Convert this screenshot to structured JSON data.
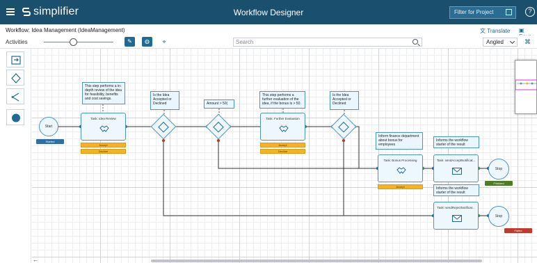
{
  "header": {
    "app_name": "simplifier",
    "title": "Workflow Designer",
    "filter_button": "Filter for Project",
    "help": "?"
  },
  "subheader": {
    "workflow_title": "Workflow: Idea Management (IdeaManagement)",
    "translate_label": "Translate",
    "save_label": "Save"
  },
  "toolbar": {
    "activities_label": "Activities",
    "search_placeholder": "Search",
    "routing_value": "Angled"
  },
  "palette": {
    "items": [
      "user-task-icon",
      "gateway-icon",
      "split-icon",
      "end-event-icon"
    ]
  },
  "diagram": {
    "start_label": "Start",
    "start_status": "Started",
    "comment1": "This step performs a in-depth review of the idea for feasibility, benefits and cost savings.",
    "task1_name": "Task: Idea Review",
    "task1_accept": "Accept",
    "task1_decline": "Decline",
    "comment_gw1": "Is the Idea Accepted or Declined",
    "comment_amount": "Amount > 50(",
    "comment2": "This step performs a further evaluation of the idea, if the bonus is > 50.",
    "task2_name": "Task: Further Evaluation",
    "task2_accept": "Accept",
    "task2_decline": "Decline",
    "comment_gw3": "Is the Idea Accepted or Declined",
    "comment_bonus": "Inform finance department about bonus for employees",
    "task3_name": "Task: Bonus Processing",
    "task3_accept": "Accept",
    "comment_inform1": "Informs the workflow starter of the result",
    "task4_name": "Task: sendAcceptNotificat...",
    "comment_inform2": "Informs the workflow starter of the result",
    "task5_name": "Task: sendRejectNotificat...",
    "stop1_label": "Stop",
    "stop1_status": "Finished",
    "stop2_label": "Stop",
    "stop2_status": "Failed"
  },
  "colors": {
    "header_bg": "#1a4f6e",
    "accent": "#1f6a95",
    "connector": "#333333",
    "success_dot": "#2e8b57",
    "error_dot": "#c0392b",
    "button_orange": "#f5b321",
    "finished_green": "#4f7a28",
    "failed_red": "#c0392b",
    "started_blue": "#2e6fa7"
  }
}
